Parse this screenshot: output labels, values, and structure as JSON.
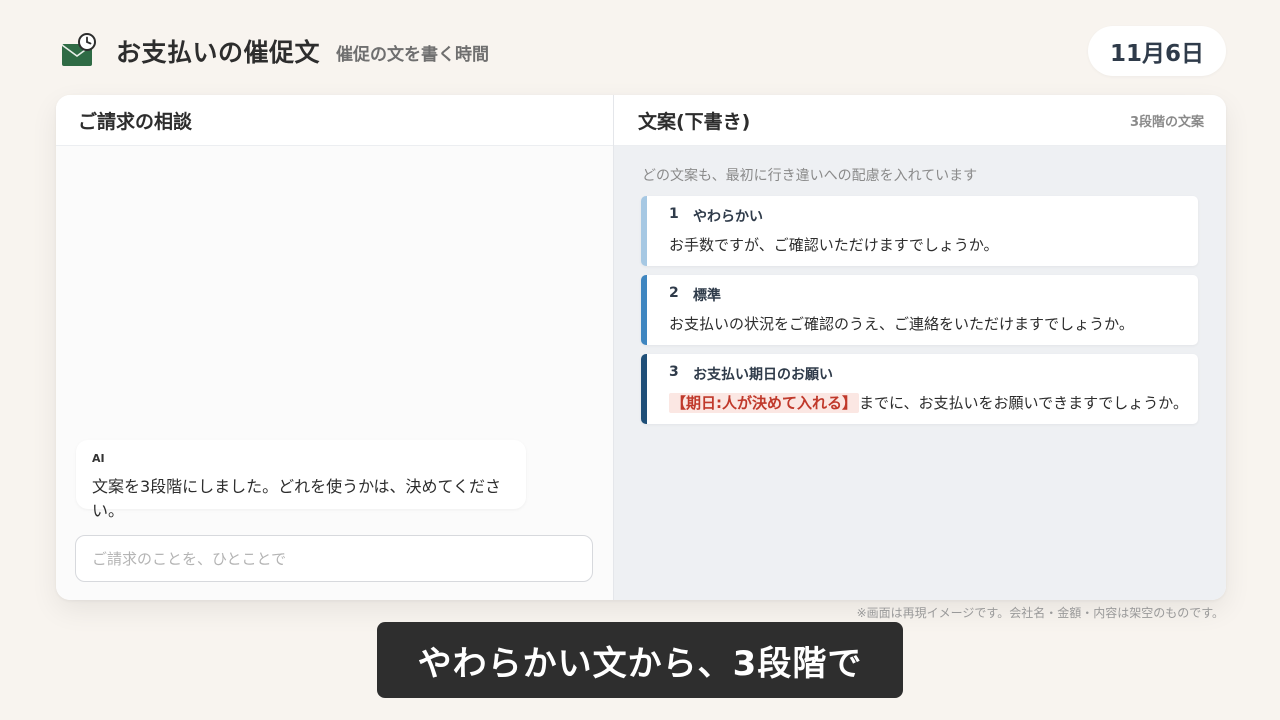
{
  "app": {
    "icon": "envelope-clock-icon",
    "title": "お支払いの催促文",
    "subtitle": "催促の文を書く時間",
    "date": "11月6日"
  },
  "chat": {
    "title": "ご請求の相談",
    "messages": [
      {
        "sender": "AI",
        "text": "文案を3段階にしました。どれを使うかは、決めてください。"
      }
    ],
    "input_placeholder": "ご請求のことを、ひとことで"
  },
  "drafts": {
    "title": "文案(下書き)",
    "badge": "3段階の文案",
    "note": "どの文案も、最初に行き違いへの配慮を入れています",
    "items": [
      {
        "num": "1",
        "label": "やわらかい",
        "text": "お手数ですが、ご確認いただけますでしょうか。"
      },
      {
        "num": "2",
        "label": "標準",
        "text": "お支払いの状況をご確認のうえ、ご連絡をいただけますでしょうか。"
      },
      {
        "num": "3",
        "label": "お支払い期日のお願い",
        "placeholder": "【期日:人が決めて入れる】",
        "text": "までに、お支払いをお願いできますでしょうか。"
      }
    ]
  },
  "disclaimer": "※画面は再現イメージです。会社名・金額・内容は架空のものです。",
  "caption": "やわらかい文から、3段階で",
  "colors": {
    "background": "#f8f4ef",
    "tier1": "#a6c8e3",
    "tier2": "#3f86c0",
    "tier3": "#1f4f78",
    "placeholder": "#c0392b",
    "icon_green": "#2f6b45"
  }
}
